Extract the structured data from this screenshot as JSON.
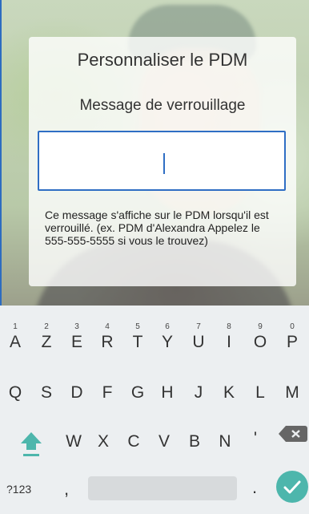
{
  "dialog": {
    "title": "Personnaliser le PDM",
    "subtitle": "Message de verrouillage",
    "input_value": "",
    "help_text": "Ce message s'affiche sur le PDM lorsqu'il est verrouillé. (ex. PDM d'Alexandra Appelez le 555-555-5555 si vous le trouvez)"
  },
  "keyboard": {
    "row1": [
      {
        "key": "A",
        "num": "1"
      },
      {
        "key": "Z",
        "num": "2"
      },
      {
        "key": "E",
        "num": "3"
      },
      {
        "key": "R",
        "num": "4"
      },
      {
        "key": "T",
        "num": "5"
      },
      {
        "key": "Y",
        "num": "6"
      },
      {
        "key": "U",
        "num": "7"
      },
      {
        "key": "I",
        "num": "8"
      },
      {
        "key": "O",
        "num": "9"
      },
      {
        "key": "P",
        "num": "0"
      }
    ],
    "row2": [
      "Q",
      "S",
      "D",
      "F",
      "G",
      "H",
      "J",
      "K",
      "L",
      "M"
    ],
    "row3": [
      "W",
      "X",
      "C",
      "V",
      "B",
      "N",
      "'"
    ],
    "symbols_label": "?123",
    "comma": ",",
    "period": ".",
    "accent_color": "#4db6ac",
    "shift_icon": "shift-icon",
    "backspace_icon": "backspace-icon",
    "enter_icon": "check-icon"
  }
}
